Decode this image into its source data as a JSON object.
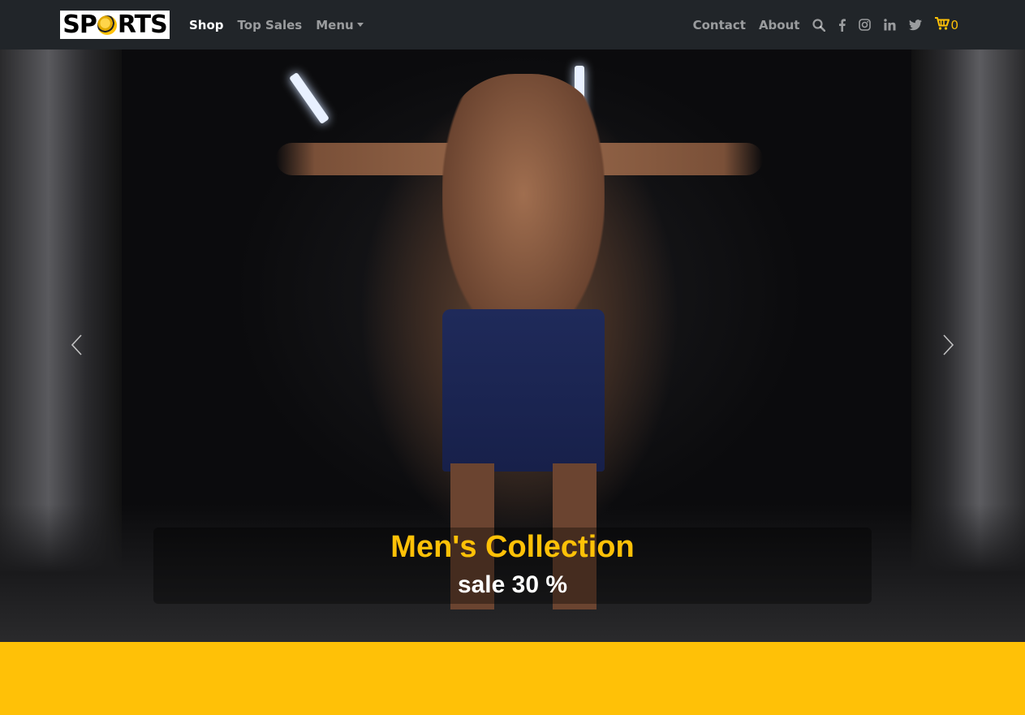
{
  "brand": {
    "logo_text_left": "SP",
    "logo_text_right": "RTS",
    "logo_alt": "SPORTS"
  },
  "nav": {
    "left": [
      {
        "label": "Shop",
        "active": true
      },
      {
        "label": "Top Sales",
        "active": false
      },
      {
        "label": "Menu",
        "active": false,
        "dropdown": true
      }
    ],
    "right": [
      {
        "label": "Contact"
      },
      {
        "label": "About"
      }
    ],
    "icons": [
      "search-icon",
      "facebook-icon",
      "instagram-icon",
      "linkedin-icon",
      "twitter-icon"
    ],
    "cart_count": "0"
  },
  "hero": {
    "title": "Men's Collection",
    "subtitle": "sale 30 %"
  },
  "colors": {
    "navbar": "#212529",
    "accent": "#ffc107",
    "nav_text": "rgba(255,255,255,0.55)"
  }
}
